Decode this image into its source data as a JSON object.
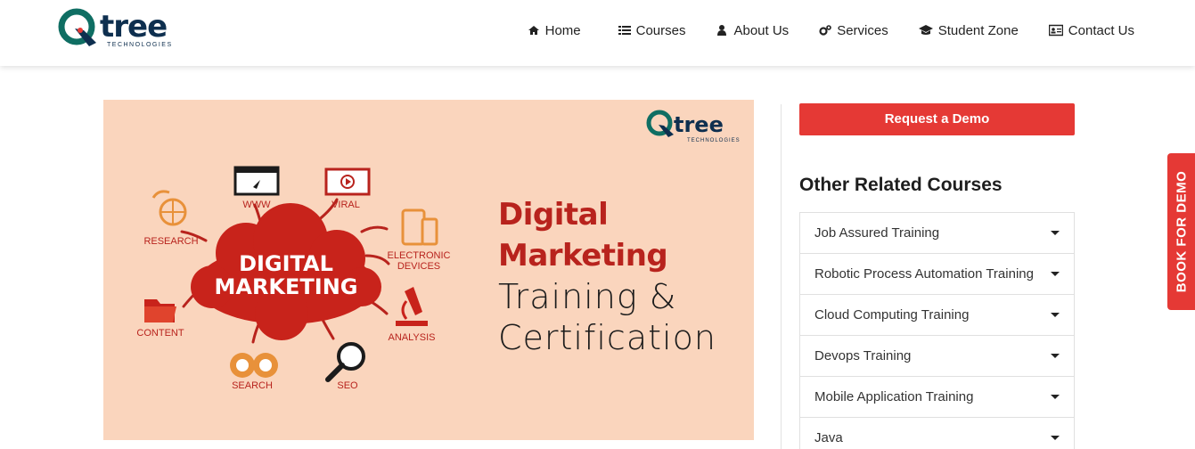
{
  "brand": {
    "name": "tree",
    "sub": "TECHNOLOGIES",
    "colors": {
      "teal": "#0f6e63",
      "navy": "#0e2f4f",
      "red": "#e53935"
    }
  },
  "nav": [
    {
      "label": "Home",
      "icon": "home-icon"
    },
    {
      "label": "Courses",
      "icon": "list-icon"
    },
    {
      "label": "About Us",
      "icon": "user-icon"
    },
    {
      "label": "Services",
      "icon": "gears-icon"
    },
    {
      "label": "Student Zone",
      "icon": "graduation-cap-icon"
    },
    {
      "label": "Contact Us",
      "icon": "address-card-icon"
    }
  ],
  "banner": {
    "logo_word": "tree",
    "logo_sub": "TECHNOLOGIES",
    "cloud_line1": "DIGITAL",
    "cloud_line2": "MARKETING",
    "labels": {
      "www": "WWW",
      "viral": "VIRAL",
      "research": "RESEARCH",
      "electronic1": "ELECTRONIC",
      "electronic2": "DEVICES",
      "content": "CONTENT",
      "analysis": "ANALYSIS",
      "search": "SEARCH",
      "seo": "SEO"
    },
    "title_line1": "Digital",
    "title_line2": "Marketing",
    "title_line3": "Training &",
    "title_line4": "Certification"
  },
  "sidebar": {
    "demo_button": "Request a Demo",
    "related_title": "Other Related Courses",
    "courses": [
      "Job Assured Training",
      "Robotic Process Automation Training",
      "Cloud Computing Training",
      "Devops Training",
      "Mobile Application Training",
      "Java"
    ]
  },
  "book_tab": "BOOK FOR DEMO"
}
